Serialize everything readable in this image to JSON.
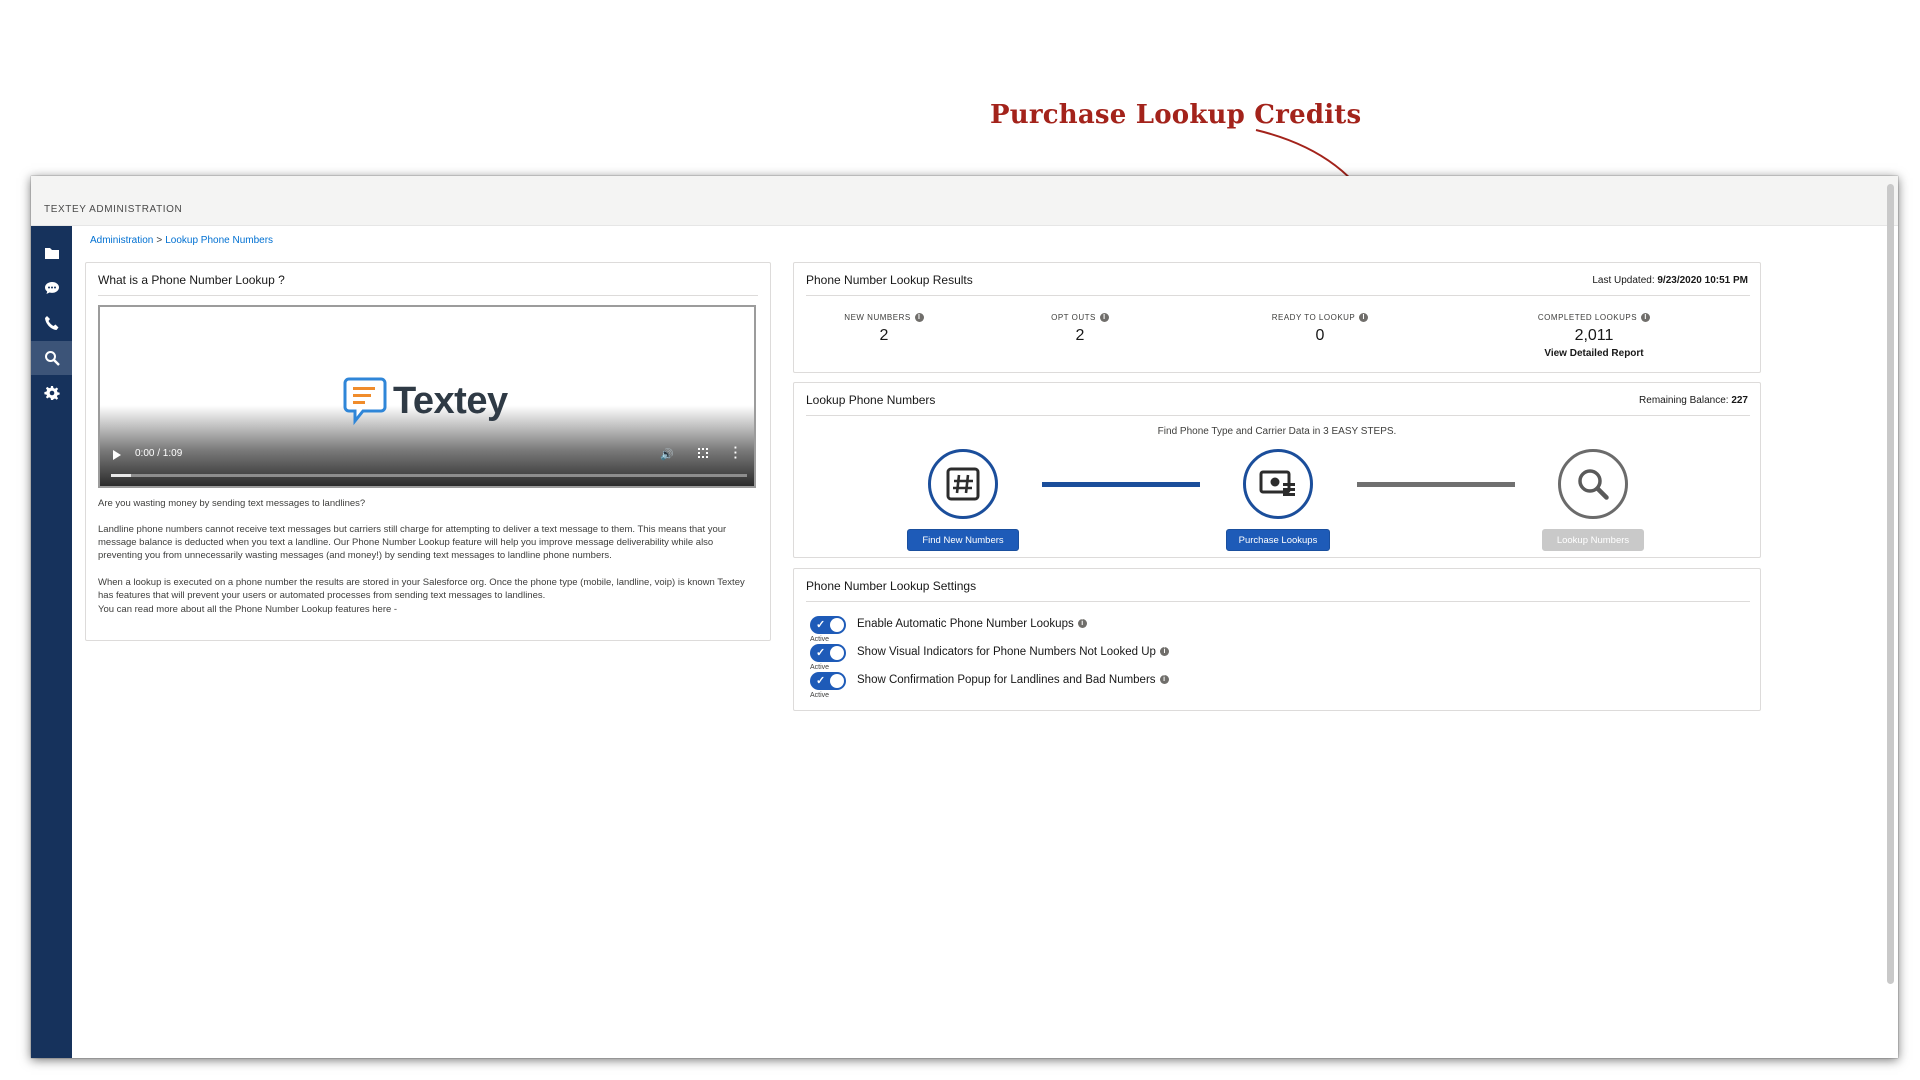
{
  "annotation": {
    "text": "Purchase Lookup Credits"
  },
  "app": {
    "title": "TEXTEY ADMINISTRATION"
  },
  "sidebar": {
    "items": [
      {
        "icon": "folder-icon"
      },
      {
        "icon": "sms-icon"
      },
      {
        "icon": "phone-icon"
      },
      {
        "icon": "search-icon",
        "active": true
      },
      {
        "icon": "gear-icon"
      }
    ]
  },
  "breadcrumb": {
    "root": "Administration",
    "separator": ">",
    "current": "Lookup Phone Numbers"
  },
  "info_card": {
    "title": "What is a Phone Number Lookup ?",
    "video": {
      "logo_text": "Textey",
      "time": "0:00 / 1:09"
    },
    "paragraphs": [
      "Are you wasting money by sending text messages to landlines?",
      "Landline phone numbers cannot receive text messages but carriers still charge for attempting to deliver a text message to them. This means that your message balance is deducted when you text a landline. Our Phone Number Lookup feature will help you improve message deliverability while also preventing you from unnecessarily wasting messages (and money!) by sending text messages to landline phone numbers.",
      "When a lookup is executed on a phone number the results are stored in your Salesforce org. Once the phone type (mobile, landline, voip) is known Textey has features that will prevent your users or automated processes from sending text messages to landlines.",
      "You can read more about all the Phone Number Lookup features here -"
    ]
  },
  "results_card": {
    "title": "Phone Number Lookup Results",
    "last_updated_label": "Last Updated:",
    "last_updated_value": "9/23/2020 10:51 PM",
    "stats": [
      {
        "label": "NEW NUMBERS",
        "value": "2"
      },
      {
        "label": "OPT OUTS",
        "value": "2"
      },
      {
        "label": "READY TO LOOKUP",
        "value": "0"
      },
      {
        "label": "COMPLETED LOOKUPS",
        "value": "2,011"
      }
    ],
    "report_link": "View Detailed Report"
  },
  "lookup_card": {
    "title": "Lookup Phone Numbers",
    "balance_label": "Remaining Balance:",
    "balance_value": "227",
    "instructions": "Find Phone Type and Carrier Data in 3 EASY STEPS.",
    "steps": [
      {
        "icon": "hash-icon",
        "button": "Find New Numbers"
      },
      {
        "icon": "money-icon",
        "button": "Purchase Lookups"
      },
      {
        "icon": "magnifier-icon",
        "button": "Lookup Numbers"
      }
    ]
  },
  "settings_card": {
    "title": "Phone Number Lookup Settings",
    "settings": [
      {
        "label": "Enable Automatic Phone Number Lookups",
        "state": "Active"
      },
      {
        "label": "Show Visual Indicators for Phone Numbers Not Looked Up",
        "state": "Active"
      },
      {
        "label": "Show Confirmation Popup for Landlines and Bad Numbers",
        "state": "Active"
      }
    ]
  },
  "colors": {
    "brand": "#16325c",
    "accent": "#1e5bb8",
    "annotation": "#a3231b"
  }
}
